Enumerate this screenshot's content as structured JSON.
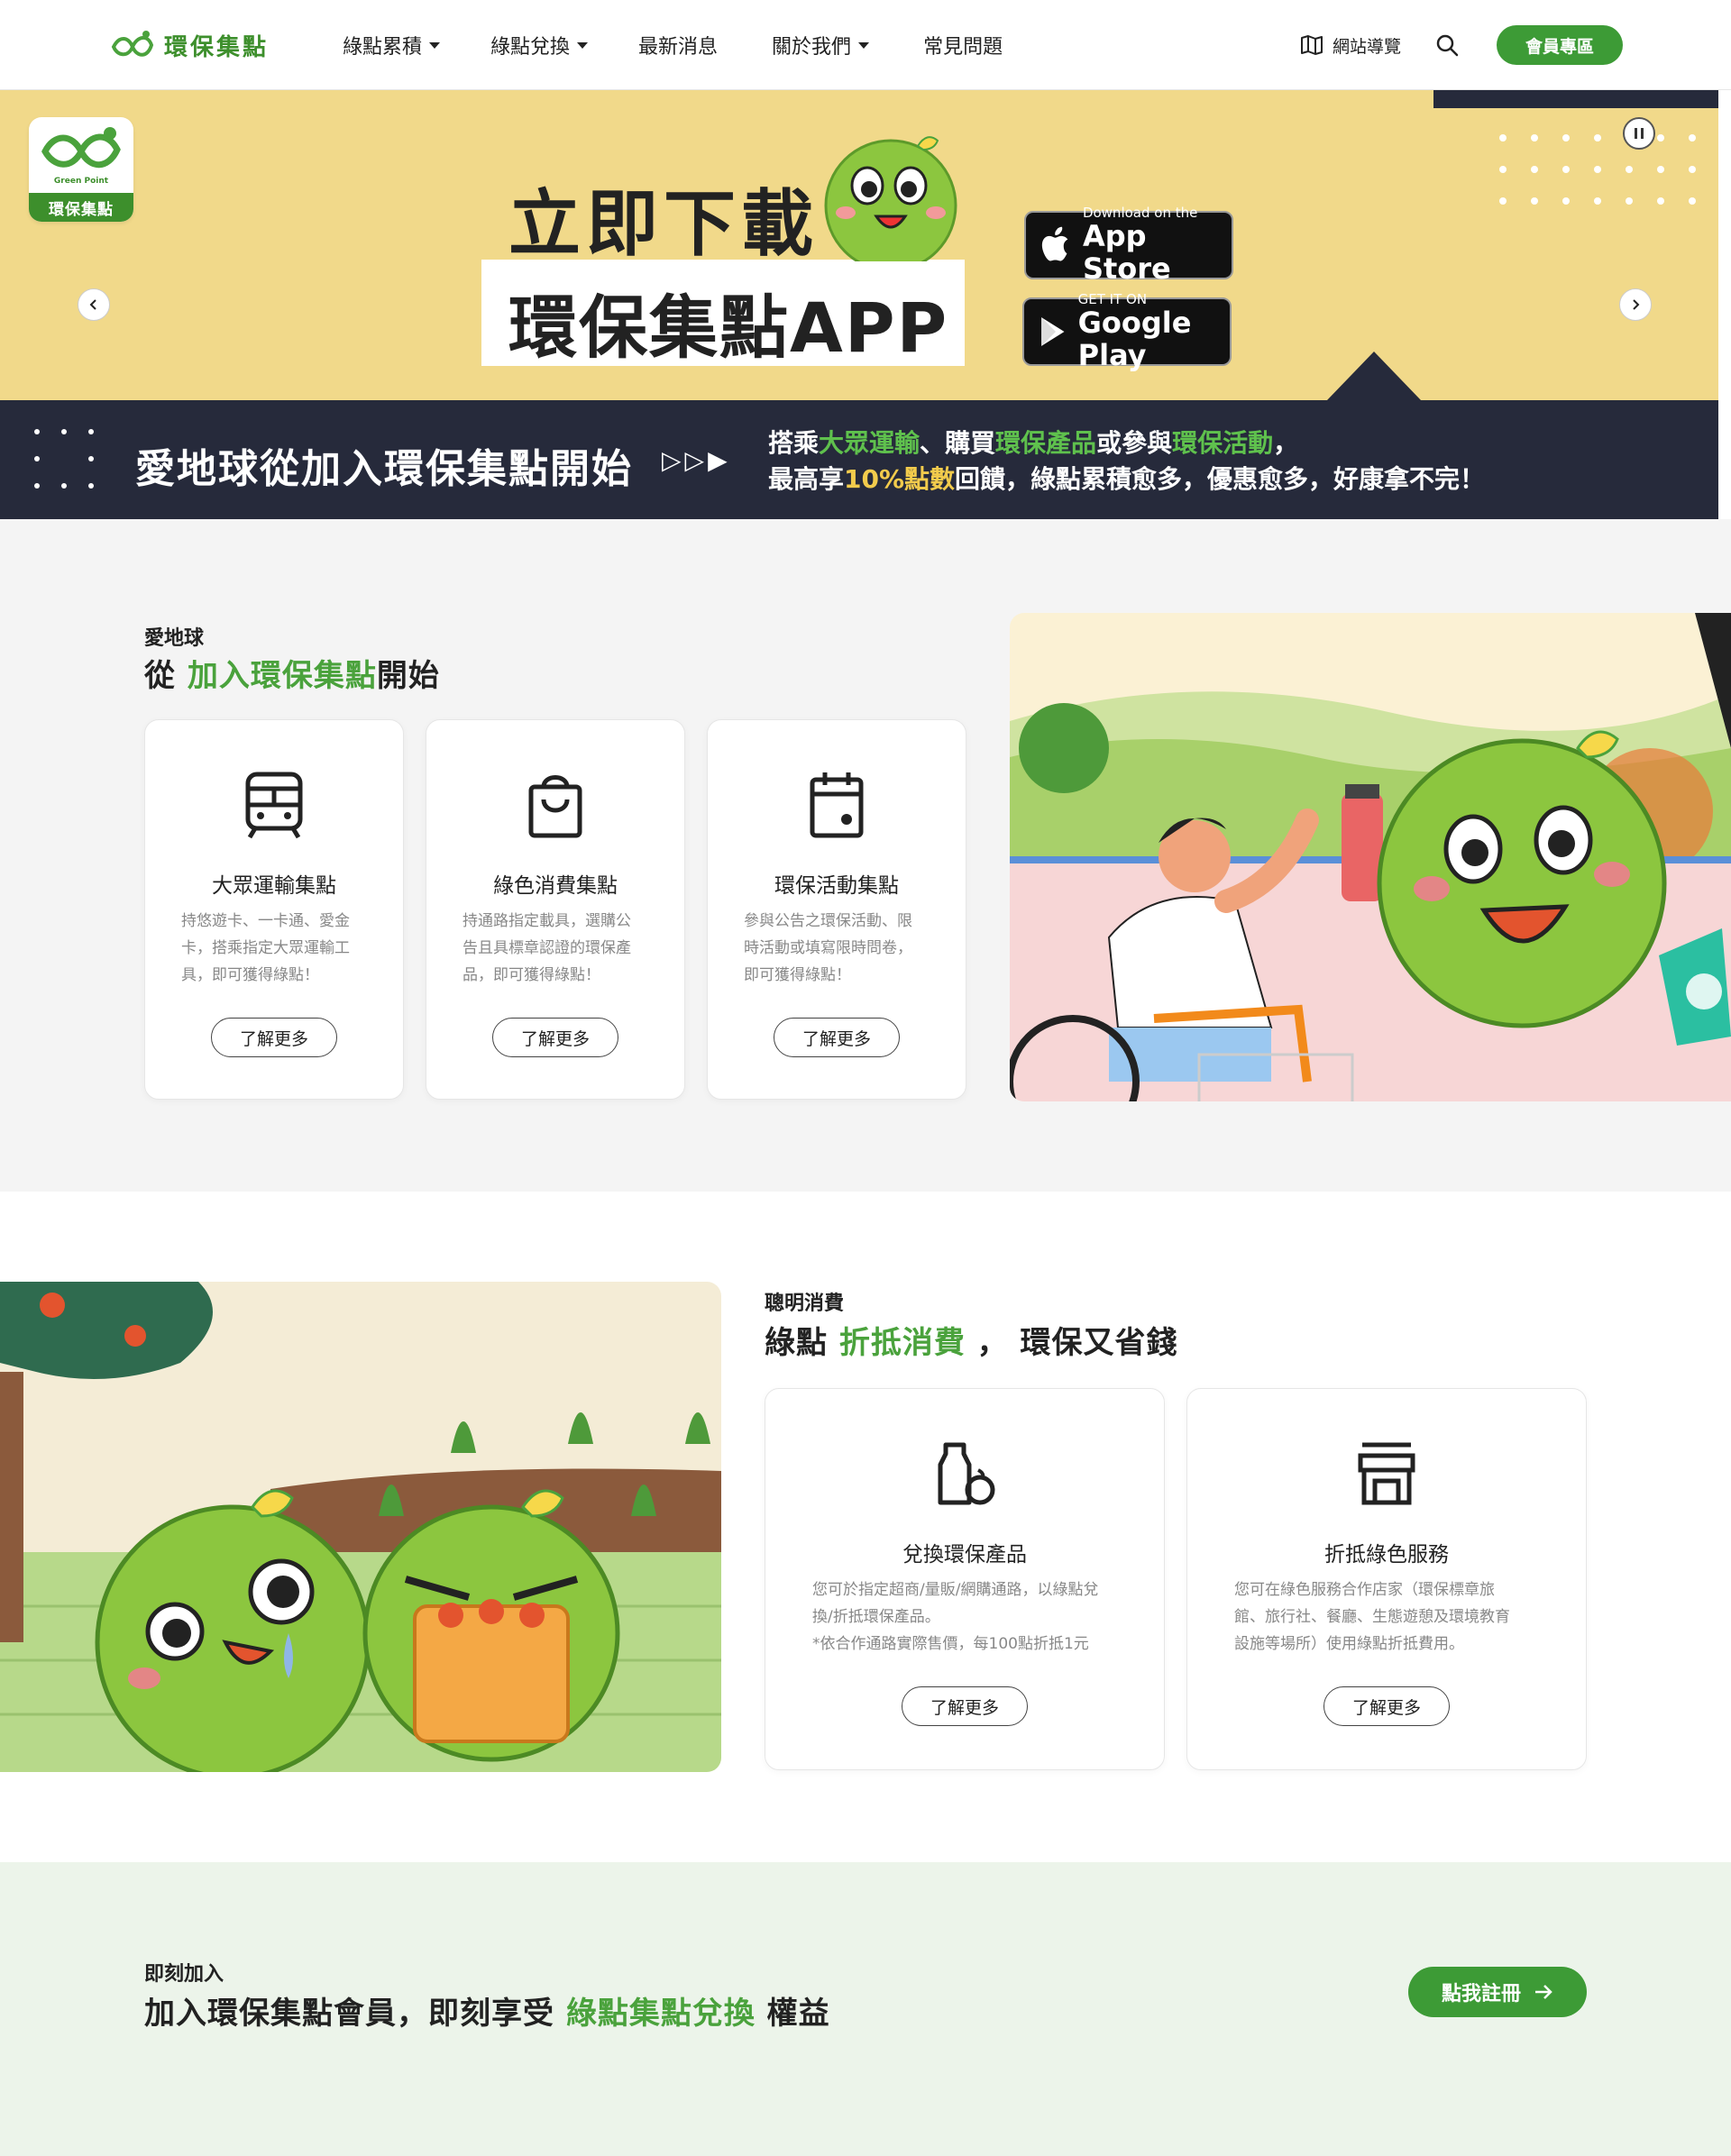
{
  "header": {
    "brand": "環保集點",
    "nav": [
      {
        "label": "綠點累積",
        "has_dropdown": true
      },
      {
        "label": "綠點兌換",
        "has_dropdown": true
      },
      {
        "label": "最新消息",
        "has_dropdown": false
      },
      {
        "label": "關於我們",
        "has_dropdown": true
      },
      {
        "label": "常見問題",
        "has_dropdown": false
      }
    ],
    "sitemap_label": "網站導覽",
    "member_label": "會員專區"
  },
  "banner": {
    "logo_caption": "Green Point",
    "logo_label": "環保集點",
    "title_line1": "立即下載",
    "title_line2": "環保集點APP",
    "appstore_small": "Download on the",
    "appstore_big": "App Store",
    "googleplay_small": "GET IT ON",
    "googleplay_big": "Google Play",
    "prev_icon": "chevron-left-icon",
    "next_icon": "chevron-right-icon",
    "pause_icon": "pause-icon"
  },
  "slogan": {
    "main": "愛地球從加入環保集點開始",
    "arrows": "▷▷▶",
    "line1_parts": [
      "搭乘",
      "大眾運輸",
      "、購買",
      "環保產品",
      "或參與",
      "環保活動",
      "，"
    ],
    "line2_parts": [
      "最高享",
      "10%點數",
      "回饋，綠點累積愈多，優惠愈多，好康拿不完！"
    ]
  },
  "section1": {
    "eyebrow": "愛地球",
    "heading_pre": "從 ",
    "heading_green": "加入環保集點",
    "heading_post": "開始",
    "cards": [
      {
        "icon": "train-icon",
        "title": "大眾運輸集點",
        "desc": [
          "持悠遊卡、一卡通、愛金",
          "卡，搭乘指定大眾運輸工",
          "具，即可獲得綠點！"
        ],
        "button": "了解更多"
      },
      {
        "icon": "shopping-bag-icon",
        "title": "綠色消費集點",
        "desc": [
          "持通路指定載具，選購公",
          "告且具標章認證的環保產",
          "品，即可獲得綠點！"
        ],
        "button": "了解更多"
      },
      {
        "icon": "calendar-icon",
        "title": "環保活動集點",
        "desc": [
          "參與公告之環保活動、限",
          "時活動或填寫限時問卷，",
          "即可獲得綠點！"
        ],
        "button": "了解更多"
      }
    ]
  },
  "section2": {
    "eyebrow": "聰明消費",
    "heading_pre": "綠點 ",
    "heading_green": "折抵消費",
    "heading_post": " ， 環保又省錢",
    "cards": [
      {
        "icon": "eco-products-icon",
        "title": "兌換環保產品",
        "desc": [
          "您可於指定超商/量販/網購通路，以綠點兌",
          "換/折抵環保產品。",
          "*依合作通路實際售價，每100點折抵1元"
        ],
        "button": "了解更多"
      },
      {
        "icon": "store-icon",
        "title": "折抵綠色服務",
        "desc": [
          "您可在綠色服務合作店家（環保標章旅",
          "館、旅行社、餐廳、生態遊憩及環境教育",
          "設施等場所）使用綠點折抵費用。"
        ],
        "button": "了解更多"
      }
    ]
  },
  "section3": {
    "eyebrow": "即刻加入",
    "heading_pre": "加入環保集點會員，即刻享受 ",
    "heading_green": "綠點集點兌換",
    "heading_post": " 權益",
    "register_label": "點我註冊"
  },
  "colors": {
    "brand_green": "#3d9b36",
    "banner_yellow": "#f1d98a",
    "dark_navy": "#262a3b",
    "section_gray": "#f4f4f4",
    "section_mint": "#ecf4ea"
  }
}
